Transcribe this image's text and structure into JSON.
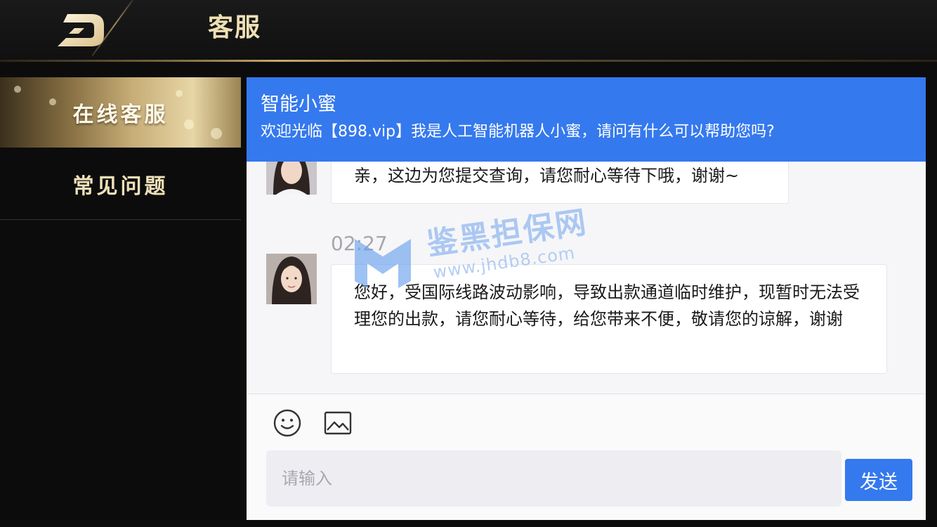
{
  "header": {
    "title": "客服"
  },
  "sidebar": {
    "items": [
      {
        "label": "在线客服",
        "active": true
      },
      {
        "label": "常见问题",
        "active": false
      }
    ]
  },
  "chat": {
    "bot_name": "智能小蜜",
    "welcome": "欢迎光临【898.vip】我是人工智能机器人小蜜，请问有什么可以帮助您吗?",
    "messages": [
      {
        "time": "",
        "text": "亲，这边为您提交查询，请您耐心等待下哦，谢谢~"
      },
      {
        "time": "02:27",
        "text": "您好，受国际线路波动影响，导致出款通道临时维护，现暂时无法受理您的出款，请您耐心等待，给您带来不便，敬请您的谅解，谢谢"
      }
    ]
  },
  "watermark": {
    "text": "鉴黑担保网",
    "url": "www.jhdb8.com"
  },
  "input": {
    "placeholder": "请输入",
    "value": ""
  },
  "send_label": "发送",
  "icons": {
    "emoji": "smiley-icon",
    "image": "image-icon",
    "logo": "brand-logo-icon"
  },
  "colors": {
    "accent": "#3579ee",
    "gold": "#efe0b4",
    "background": "#0c0c0c"
  }
}
